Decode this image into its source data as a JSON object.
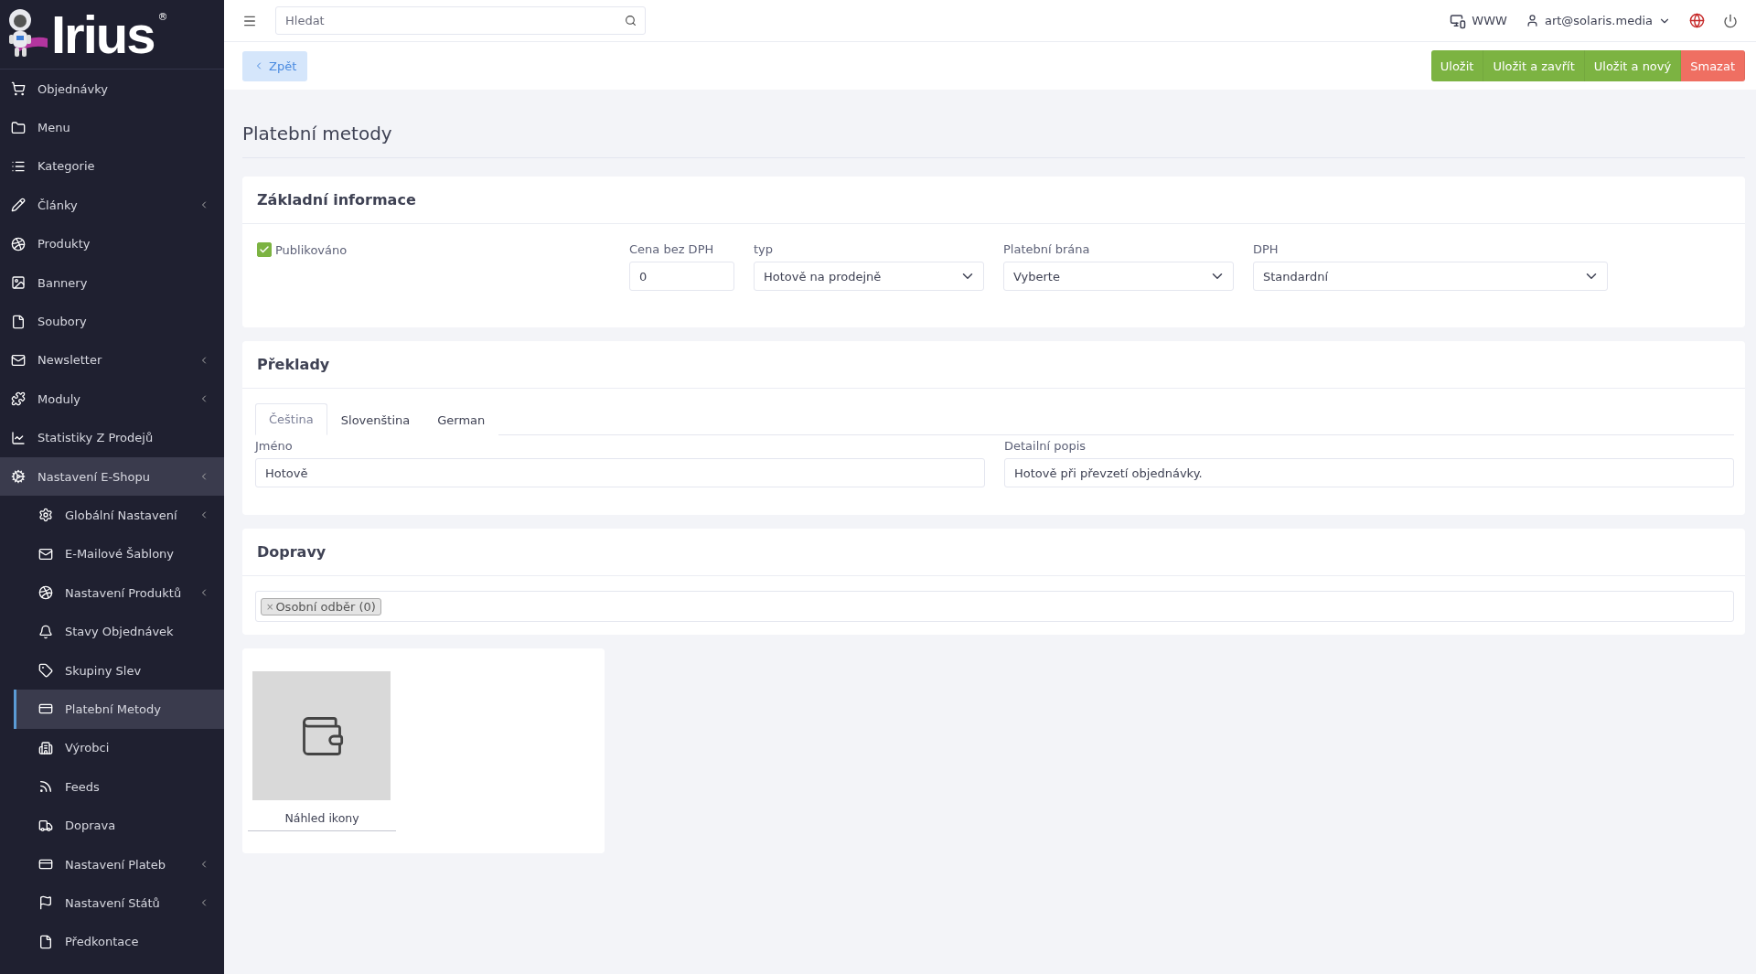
{
  "logo": {
    "text": "Irius",
    "mark": "®"
  },
  "sidebar": {
    "items": [
      {
        "label": "Objednávky",
        "has_submenu": false,
        "expanded": false,
        "selected": false
      },
      {
        "label": "Menu",
        "has_submenu": false,
        "expanded": false,
        "selected": false
      },
      {
        "label": "Kategorie",
        "has_submenu": false,
        "expanded": false,
        "selected": false
      },
      {
        "label": "Články",
        "has_submenu": true,
        "expanded": false,
        "selected": false
      },
      {
        "label": "Produkty",
        "has_submenu": false,
        "expanded": false,
        "selected": false
      },
      {
        "label": "Bannery",
        "has_submenu": false,
        "expanded": false,
        "selected": false
      },
      {
        "label": "Soubory",
        "has_submenu": false,
        "expanded": false,
        "selected": false
      },
      {
        "label": "Newsletter",
        "has_submenu": true,
        "expanded": false,
        "selected": false
      },
      {
        "label": "Moduly",
        "has_submenu": true,
        "expanded": false,
        "selected": false
      },
      {
        "label": "Statistiky Z Prodejů",
        "has_submenu": false,
        "expanded": false,
        "selected": false
      },
      {
        "label": "Nastavení E-Shopu",
        "has_submenu": true,
        "expanded": true,
        "selected": false,
        "children": [
          {
            "label": "Globální Nastavení",
            "has_submenu": true,
            "selected": false
          },
          {
            "label": "E-Mailové Šablony",
            "has_submenu": false,
            "selected": false
          },
          {
            "label": "Nastavení Produktů",
            "has_submenu": true,
            "selected": false
          },
          {
            "label": "Stavy Objednávek",
            "has_submenu": false,
            "selected": false
          },
          {
            "label": "Skupiny Slev",
            "has_submenu": false,
            "selected": false
          },
          {
            "label": "Platební Metody",
            "has_submenu": false,
            "selected": true
          },
          {
            "label": "Výrobci",
            "has_submenu": false,
            "selected": false
          },
          {
            "label": "Feeds",
            "has_submenu": false,
            "selected": false
          },
          {
            "label": "Doprava",
            "has_submenu": false,
            "selected": false
          },
          {
            "label": "Nastavení Plateb",
            "has_submenu": true,
            "selected": false
          },
          {
            "label": "Nastavení Států",
            "has_submenu": true,
            "selected": false
          },
          {
            "label": "Předkontace",
            "has_submenu": false,
            "selected": false
          }
        ]
      }
    ]
  },
  "topbar": {
    "search": {
      "placeholder": "Hledat"
    },
    "www": "WWW",
    "user": "art@solaris.media"
  },
  "toolbar": {
    "back": "Zpět",
    "buttons": [
      {
        "label": "Uložit",
        "kind": "save"
      },
      {
        "label": "Uložit a zavřít",
        "kind": "save"
      },
      {
        "label": "Uložit a nový",
        "kind": "save"
      },
      {
        "label": "Smazat",
        "kind": "delete"
      }
    ]
  },
  "page_title": "Platební metody",
  "basic_info": {
    "title": "Základní informace",
    "published": {
      "label": "Publikováno",
      "checked": true
    },
    "price": {
      "label": "Cena bez DPH",
      "value": "0"
    },
    "type": {
      "label": "typ",
      "value": "Hotově na prodejně"
    },
    "gateway": {
      "label": "Platební brána",
      "value": "Vyberte"
    },
    "vat": {
      "label": "DPH",
      "value": "Standardní"
    }
  },
  "translations": {
    "title": "Překlady",
    "tabs": [
      {
        "label": "Čeština",
        "selected": true
      },
      {
        "label": "Slovenština",
        "selected": false
      },
      {
        "label": "German",
        "selected": false
      }
    ],
    "name": {
      "label": "Jméno",
      "value": "Hotově"
    },
    "description": {
      "label": "Detailní popis",
      "value": "Hotově při převzetí objednávky."
    }
  },
  "shipping": {
    "title": "Dopravy",
    "tags": [
      {
        "remove": "×",
        "label": "Osobní odběr (0)"
      }
    ]
  },
  "icon_preview": {
    "caption": "Náhled ikony"
  }
}
